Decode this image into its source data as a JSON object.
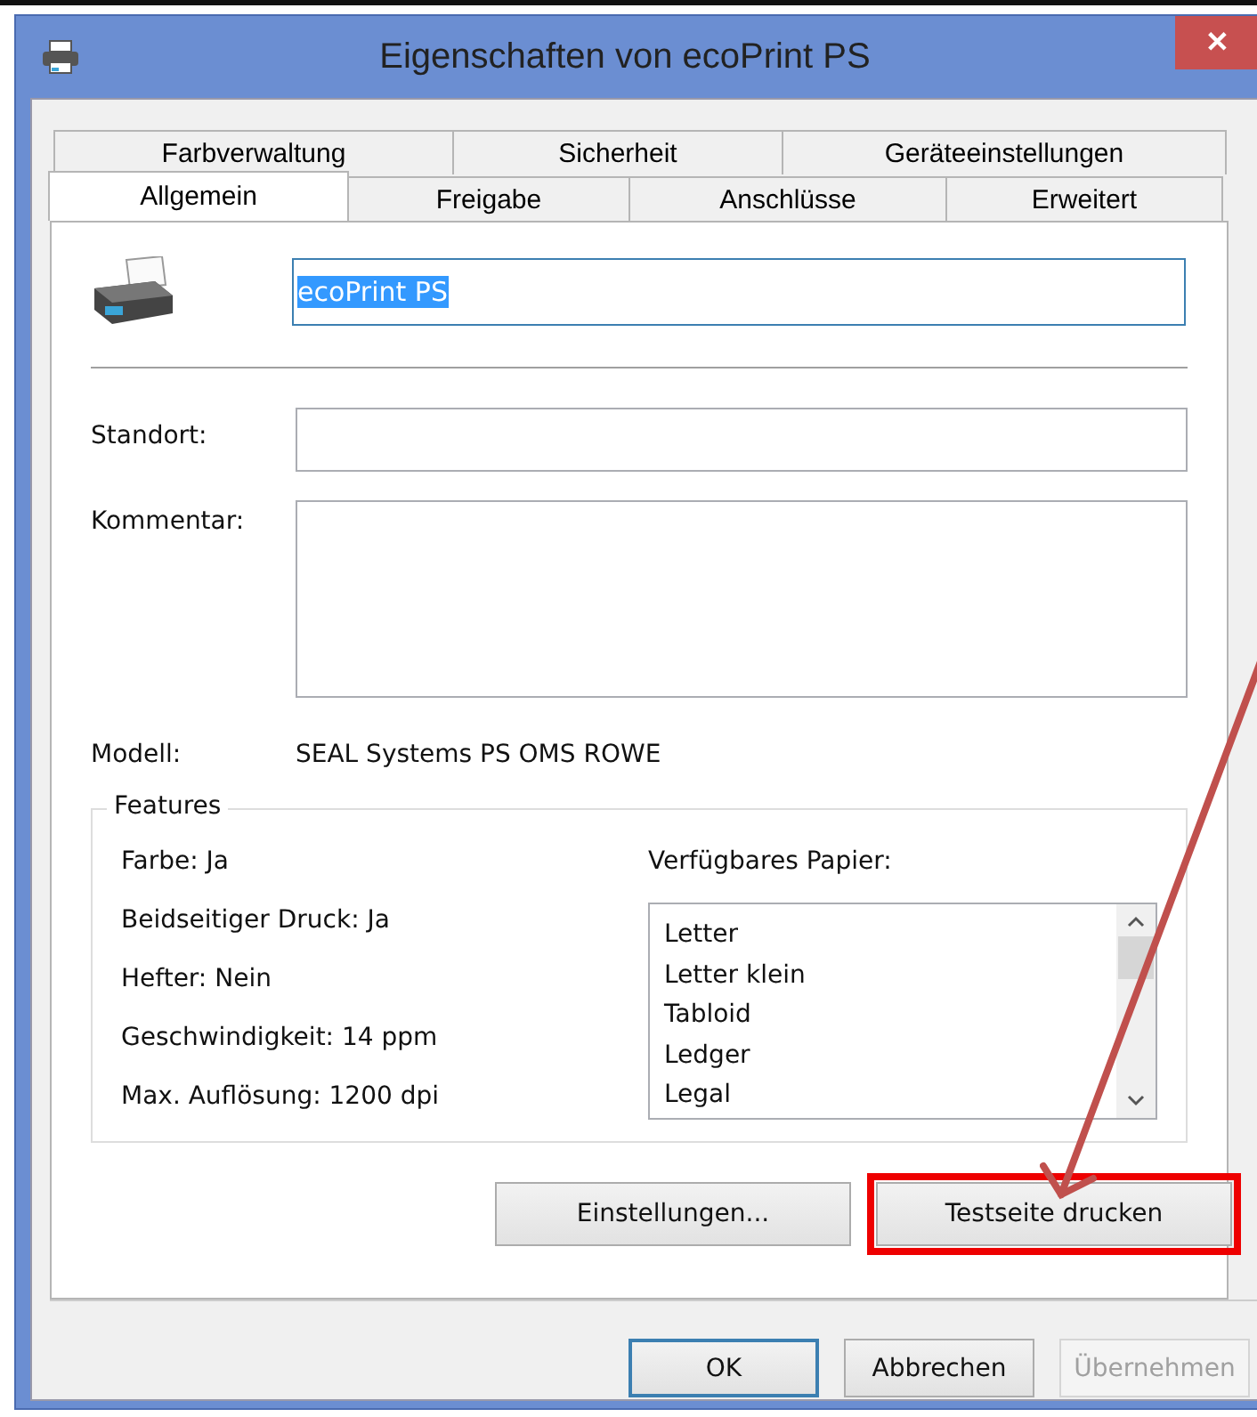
{
  "window": {
    "title": "Eigenschaften von ecoPrint PS",
    "close": "✕"
  },
  "tabs": [
    [
      {
        "label": "Farbverwaltung",
        "selected": false
      },
      {
        "label": "Sicherheit",
        "selected": false
      },
      {
        "label": "Geräteeinstellungen",
        "selected": false
      }
    ],
    [
      {
        "label": "Allgemein",
        "selected": true
      },
      {
        "label": "Freigabe",
        "selected": false
      },
      {
        "label": "Anschlüsse",
        "selected": false
      },
      {
        "label": "Erweitert",
        "selected": false
      }
    ]
  ],
  "printer_name": {
    "value": "ecoPrint PS",
    "selected": true
  },
  "fields": [
    {
      "label": "Standort:",
      "kind": "line"
    },
    {
      "label": "Kommentar:",
      "kind": "area"
    }
  ],
  "model": {
    "label": "Modell:",
    "value": "SEAL Systems PS OMS ROWE"
  },
  "features": {
    "title": "Features",
    "items": [
      "Farbe: Ja",
      "Beidseitiger Druck: Ja",
      "Hefter: Nein",
      "Geschwindigkeit: 14 ppm",
      "Max. Auflösung: 1200 dpi"
    ],
    "paper_label": "Verfügbares Papier:",
    "paper": [
      "Letter",
      "Letter klein",
      "Tabloid",
      "Ledger",
      "Legal"
    ]
  },
  "page_buttons": [
    {
      "label": "Einstellungen...",
      "highlighted": false
    },
    {
      "label": "Testseite drucken",
      "highlighted": true
    }
  ],
  "dialog_buttons": [
    {
      "label": "OK",
      "default": true,
      "disabled": false
    },
    {
      "label": "Abbrechen",
      "default": false,
      "disabled": false
    },
    {
      "label": "Übernehmen",
      "default": false,
      "disabled": true
    }
  ]
}
